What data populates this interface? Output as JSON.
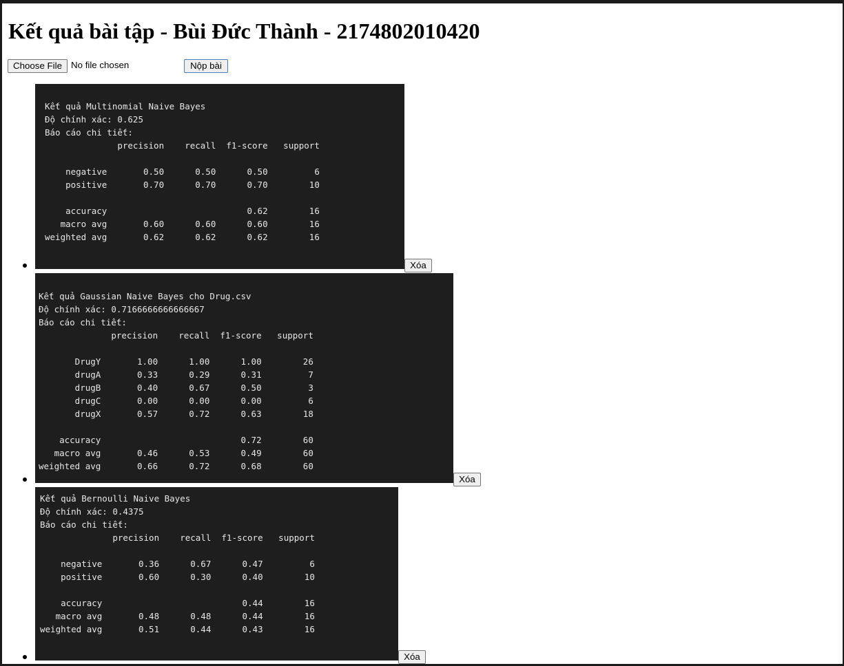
{
  "page": {
    "title": "Kết quả bài tập - Bùi Đức Thành - 2174802010420"
  },
  "upload": {
    "choose_file_label": "Choose File",
    "file_status": "No file chosen",
    "submit_label": "Nộp bài"
  },
  "results": [
    {
      "header": "Kết quả Multinomial Naive Bayes",
      "accuracy_line": "Độ chính xác: 0.625",
      "report_label": "Báo cáo chi tiết:",
      "report": "              precision    recall  f1-score   support\n\n    negative       0.50      0.50      0.50         6\n    positive       0.70      0.70      0.70        10\n\n    accuracy                           0.62        16\n   macro avg       0.60      0.60      0.60        16\nweighted avg       0.62      0.62      0.62        16",
      "delete_label": "Xóa"
    },
    {
      "header": "Kết quả Gaussian Naive Bayes cho Drug.csv",
      "accuracy_line": "Độ chính xác: 0.7166666666666667",
      "report_label": "Báo cáo chi tiết:",
      "report": "              precision    recall  f1-score   support\n\n       DrugY       1.00      1.00      1.00        26\n       drugA       0.33      0.29      0.31         7\n       drugB       0.40      0.67      0.50         3\n       drugC       0.00      0.00      0.00         6\n       drugX       0.57      0.72      0.63        18\n\n    accuracy                           0.72        60\n   macro avg       0.46      0.53      0.49        60\nweighted avg       0.66      0.72      0.68        60",
      "delete_label": "Xóa"
    },
    {
      "header": "Kết quả Bernoulli Naive Bayes",
      "accuracy_line": "Độ chính xác: 0.4375",
      "report_label": "Báo cáo chi tiết:",
      "report": "              precision    recall  f1-score   support\n\n    negative       0.36      0.67      0.47         6\n    positive       0.60      0.30      0.40        10\n\n    accuracy                           0.44        16\n   macro avg       0.48      0.48      0.44        16\nweighted avg       0.51      0.44      0.43        16",
      "delete_label": "Xóa"
    }
  ]
}
